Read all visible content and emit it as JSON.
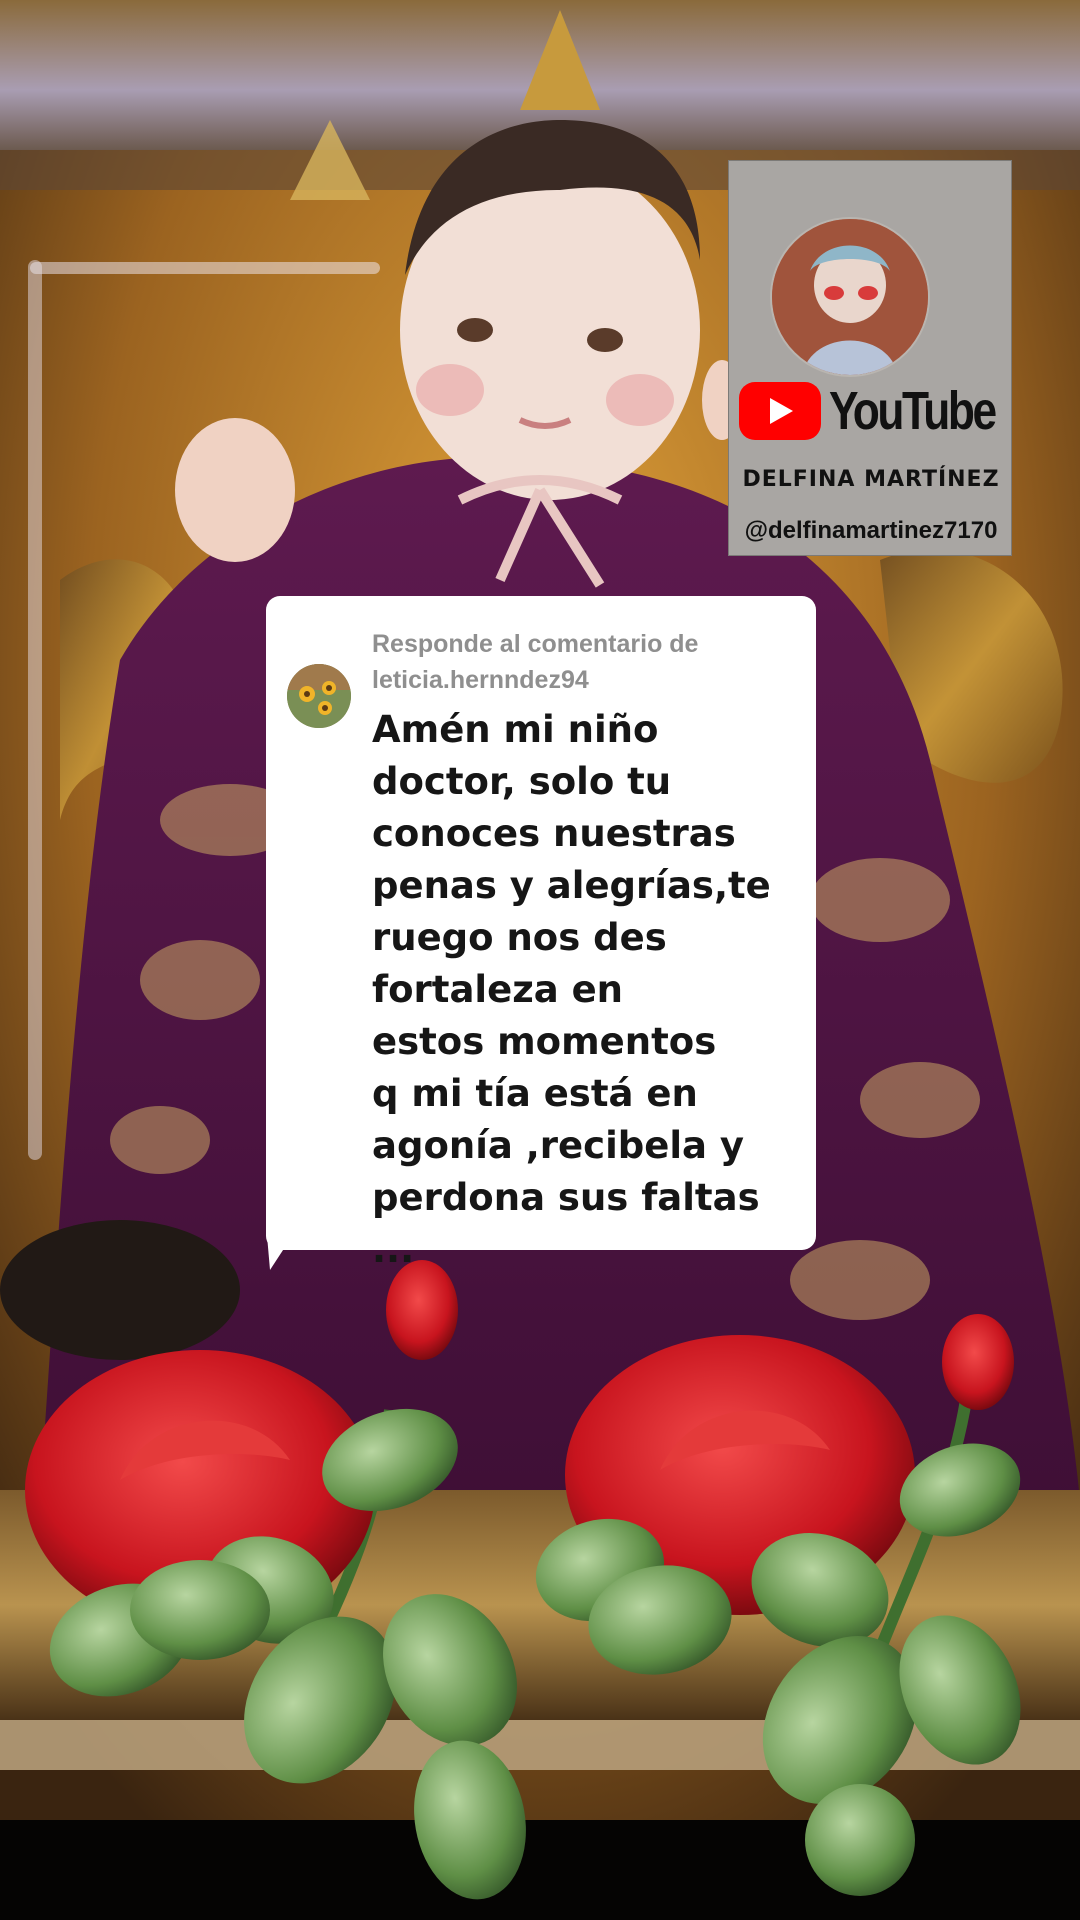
{
  "youtube_card": {
    "brand": "YouTube",
    "channel_name": "DELFINA MARTÍNEZ",
    "handle": "@delfinamartinez7170"
  },
  "comment": {
    "reply_label": "Responde al comentario de leticia.hernndez94",
    "text": "Amén mi niño\ndoctor, solo tu\nconoces nuestras\npenas y alegrías,te\nruego nos des\nfortaleza en\nestos momentos\nq mi tía está en\nagonía ,recibela y\nperdona sus faltas ..."
  },
  "colors": {
    "youtube_red": "#ff0000",
    "card_gray": "#a9a6a3",
    "bubble_white": "#ffffff",
    "reply_gray": "#8f8f8f",
    "rose_red": "#c8141e",
    "robe_purple": "#5a1a4d"
  }
}
